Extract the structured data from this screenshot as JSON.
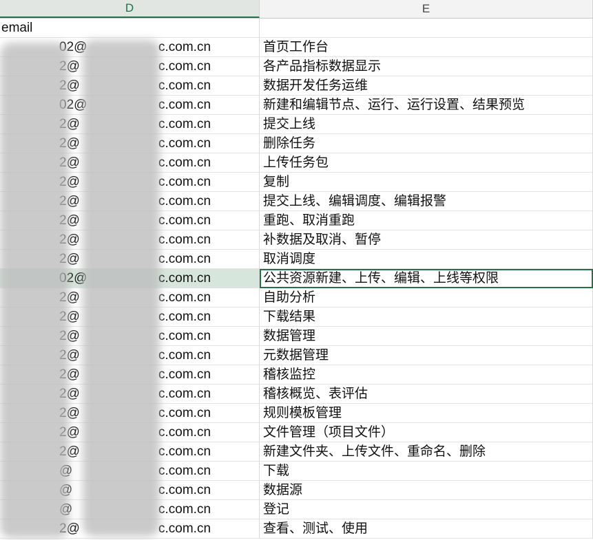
{
  "columns": {
    "d": "D",
    "e": "E"
  },
  "header_row": {
    "d": "email",
    "e": ""
  },
  "rows": [
    {
      "email_a": "02@",
      "email_b": "c.com.cn",
      "perm": "首页工作台"
    },
    {
      "email_a": "2@",
      "email_b": "c.com.cn",
      "perm": "各产品指标数据显示"
    },
    {
      "email_a": "2@",
      "email_b": "c.com.cn",
      "perm": "数据开发任务运维"
    },
    {
      "email_a": "02@",
      "email_b": "c.com.cn",
      "perm": "新建和编辑节点、运行、运行设置、结果预览"
    },
    {
      "email_a": "2@",
      "email_b": "c.com.cn",
      "perm": "提交上线"
    },
    {
      "email_a": "2@",
      "email_b": "c.com.cn",
      "perm": "删除任务"
    },
    {
      "email_a": "2@",
      "email_b": "c.com.cn",
      "perm": "上传任务包"
    },
    {
      "email_a": "2@",
      "email_b": "c.com.cn",
      "perm": "复制"
    },
    {
      "email_a": "2@",
      "email_b": "c.com.cn",
      "perm": "提交上线、编辑调度、编辑报警"
    },
    {
      "email_a": "2@",
      "email_b": "c.com.cn",
      "perm": "重跑、取消重跑"
    },
    {
      "email_a": "2@",
      "email_b": "c.com.cn",
      "perm": "补数据及取消、暂停"
    },
    {
      "email_a": "2@",
      "email_b": "c.com.cn",
      "perm": "取消调度"
    },
    {
      "email_a": "02@",
      "email_b": "c.com.cn",
      "perm": "公共资源新建、上传、编辑、上线等权限"
    },
    {
      "email_a": "2@",
      "email_b": "c.com.cn",
      "perm": "自助分析"
    },
    {
      "email_a": "2@",
      "email_b": "c.com.cn",
      "perm": "下载结果"
    },
    {
      "email_a": "2@",
      "email_b": "c.com.cn",
      "perm": "数据管理"
    },
    {
      "email_a": "2@",
      "email_b": "c.com.cn",
      "perm": "元数据管理"
    },
    {
      "email_a": "2@",
      "email_b": "c.com.cn",
      "perm": "稽核监控"
    },
    {
      "email_a": "2@",
      "email_b": "c.com.cn",
      "perm": "稽核概览、表评估"
    },
    {
      "email_a": "2@",
      "email_b": "c.com.cn",
      "perm": "规则模板管理"
    },
    {
      "email_a": "2@",
      "email_b": "c.com.cn",
      "perm": "文件管理（项目文件）"
    },
    {
      "email_a": "2@",
      "email_b": "c.com.cn",
      "perm": "新建文件夹、上传文件、重命名、删除"
    },
    {
      "email_a": "@",
      "email_b": "c.com.cn",
      "perm": "下载"
    },
    {
      "email_a": "@",
      "email_b": "c.com.cn",
      "perm": "数据源"
    },
    {
      "email_a": "@",
      "email_b": "c.com.cn",
      "perm": "登记"
    },
    {
      "email_a": "2@",
      "email_b": "c.com.cn",
      "perm": "查看、测试、使用"
    }
  ],
  "selected_row_index": 12,
  "colors": {
    "accent": "#217346",
    "highlight": "#d6e6dc"
  }
}
